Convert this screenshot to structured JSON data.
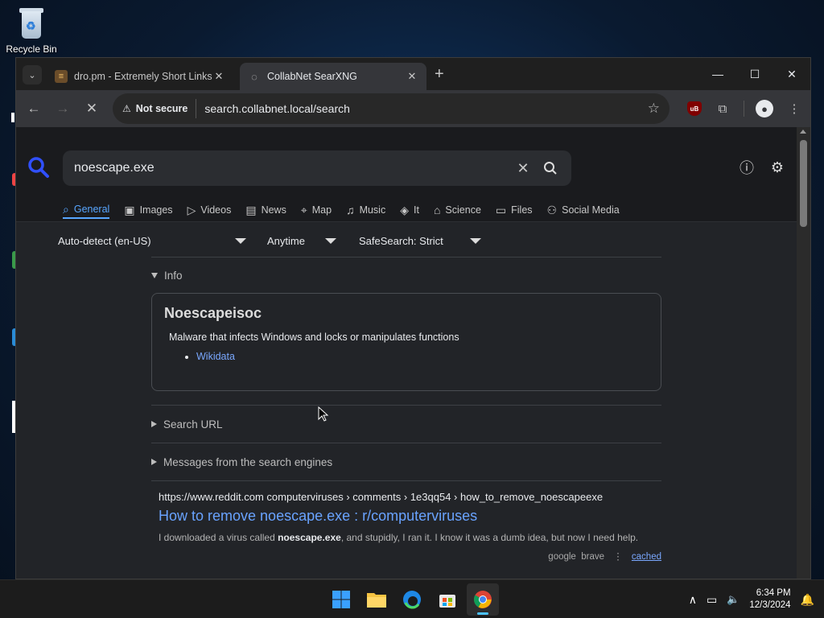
{
  "desktop": {
    "recycle_bin_label": "Recycle Bin"
  },
  "browser": {
    "tabs": [
      {
        "title": "dro.pm - Extremely Short Links",
        "active": false
      },
      {
        "title": "CollabNet SearXNG",
        "active": true
      }
    ],
    "new_tab_glyph": "+",
    "security_label": "Not secure",
    "url": "search.collabnet.local/search"
  },
  "searxng": {
    "query": "noescape.exe",
    "categories": [
      {
        "label": "General",
        "icon": "search-icon",
        "active": true
      },
      {
        "label": "Images",
        "icon": "image-icon",
        "active": false
      },
      {
        "label": "Videos",
        "icon": "play-icon",
        "active": false
      },
      {
        "label": "News",
        "icon": "newspaper-icon",
        "active": false
      },
      {
        "label": "Map",
        "icon": "map-pin-icon",
        "active": false
      },
      {
        "label": "Music",
        "icon": "music-icon",
        "active": false
      },
      {
        "label": "It",
        "icon": "layers-icon",
        "active": false
      },
      {
        "label": "Science",
        "icon": "school-icon",
        "active": false
      },
      {
        "label": "Files",
        "icon": "files-icon",
        "active": false
      },
      {
        "label": "Social Media",
        "icon": "people-icon",
        "active": false
      }
    ],
    "filters": {
      "language": "Auto-detect (en-US)",
      "time": "Anytime",
      "safesearch": "SafeSearch: Strict"
    },
    "info_section_label": "Info",
    "infobox": {
      "title": "Noescapeisoc",
      "description": "Malware that infects Windows and locks or manipulates functions",
      "link": "Wikidata"
    },
    "search_url_label": "Search URL",
    "messages_label": "Messages from the search engines",
    "results": [
      {
        "url": "https://www.reddit.com  computerviruses › comments › 1e3qq54 › how_to_remove_noescapeexe",
        "title": "How to remove noescape.exe : r/computerviruses",
        "snippet_pre": "I downloaded a virus called ",
        "snippet_bold": "noescape.exe",
        "snippet_post": ", and stupidly, I ran it. I know it was a dumb idea, but now I need help.",
        "engines": "google  brave",
        "cached": "cached"
      }
    ]
  },
  "taskbar": {
    "time": "6:34 PM",
    "date": "12/3/2024"
  },
  "colors": {
    "accent": "#58a6ff",
    "link": "#69a3ff",
    "background": "#222428"
  }
}
